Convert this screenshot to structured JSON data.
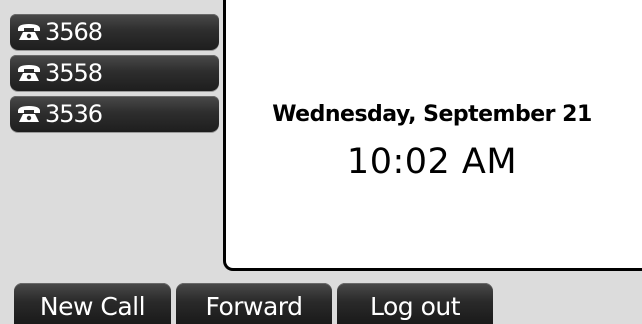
{
  "lines": [
    {
      "label": "3568",
      "icon": "phone-handset-icon"
    },
    {
      "label": "3558",
      "icon": "phone-handset-icon"
    },
    {
      "label": "3536",
      "icon": "phone-handset-icon"
    }
  ],
  "status": {
    "date": "Wednesday, September 21",
    "time": "10:02 AM"
  },
  "softkeys": {
    "new_call": "New Call",
    "forward": "Forward",
    "log_out": "Log out"
  },
  "colors": {
    "key_background": "#2e2e2e",
    "key_text": "#ffffff",
    "screen_background": "#dcdcdc",
    "panel_background": "#ffffff"
  }
}
